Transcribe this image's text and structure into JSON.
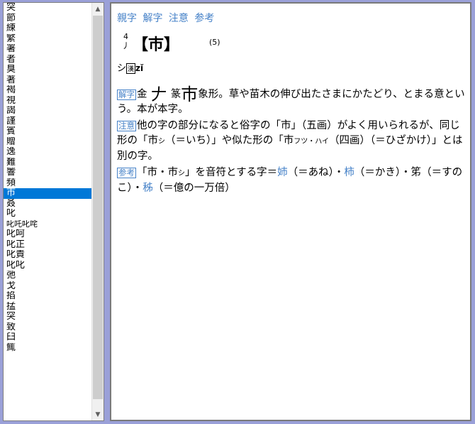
{
  "list": {
    "items": [
      {
        "text": "突"
      },
      {
        "text": "節"
      },
      {
        "text": "練"
      },
      {
        "text": "繁"
      },
      {
        "text": "署"
      },
      {
        "text": "者"
      },
      {
        "text": "臭"
      },
      {
        "text": "著"
      },
      {
        "text": "褐"
      },
      {
        "text": "視"
      },
      {
        "text": "謁"
      },
      {
        "text": "謹"
      },
      {
        "text": "賓"
      },
      {
        "text": "贈"
      },
      {
        "text": "逸"
      },
      {
        "text": "難"
      },
      {
        "text": "響"
      },
      {
        "text": "頻"
      },
      {
        "text": "巿",
        "selected": true
      },
      {
        "text": "叒"
      },
      {
        "text": "叱"
      },
      {
        "text": "叱吒叱咤",
        "small": true
      },
      {
        "text": "叱呵"
      },
      {
        "text": "叱正"
      },
      {
        "text": "叱責"
      },
      {
        "text": "叱叱"
      },
      {
        "text": "弛"
      },
      {
        "text": "戈"
      },
      {
        "text": "掐"
      },
      {
        "text": "掹"
      },
      {
        "text": "突"
      },
      {
        "text": "致"
      },
      {
        "text": "臼"
      },
      {
        "text": "鮿"
      }
    ]
  },
  "nav": [
    "親字",
    "解字",
    "注意",
    "参考"
  ],
  "headword": {
    "radical_num": "4",
    "radical": "丿",
    "kanji": "【巿】",
    "strokes": "(5)"
  },
  "reading": {
    "kana": "シ",
    "kind": "漢",
    "pinyin": "zǐ"
  },
  "paragraphs": {
    "kaiji": {
      "label": "解字",
      "text1": "金",
      "glyph1": "𠂇",
      "text2": "篆",
      "glyph2": "巿",
      "text3": "象形。草や苗木の伸び出たさまにかたどり、とまる意という。本が本字。"
    },
    "chui": {
      "label": "注意",
      "text": "他の字の部分になると俗字の「市」（五画）がよく用いられるが、同じ形の「市",
      "note1": "シ",
      "text2": "（＝いち）」や似た形の「巿",
      "note2": "フツ・ハイ",
      "text3": "（四画）（＝ひざかけ）」とは別の字。"
    },
    "sanko": {
      "label": "参考",
      "text1": "「市・巿",
      "note1": "シ",
      "text2": "」を音符とする字＝",
      "link1": "姉",
      "text3": "（＝あね）・",
      "link2": "柿",
      "text4": "（＝かき）・笫（＝すのこ）・",
      "link3": "秭",
      "text5": "（＝億の一万倍）"
    }
  },
  "colors": {
    "link": "#4682c8",
    "selection": "#0078d7",
    "frame": "#9aa0d8"
  }
}
